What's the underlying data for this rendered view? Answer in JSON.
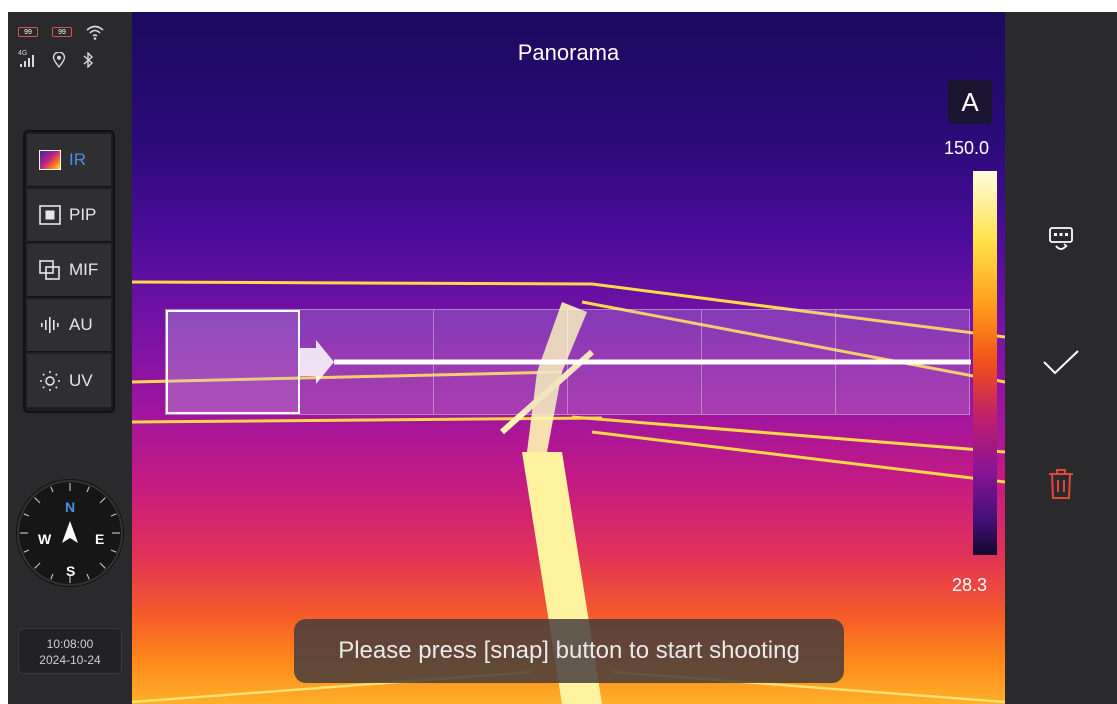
{
  "status_bar": {
    "battery_1": "99",
    "battery_2": "99",
    "signal_label": "4G"
  },
  "modes": [
    {
      "label": "IR",
      "active": true
    },
    {
      "label": "PIP",
      "active": false
    },
    {
      "label": "MIF",
      "active": false
    },
    {
      "label": "AU",
      "active": false
    },
    {
      "label": "UV",
      "active": false
    }
  ],
  "compass": {
    "n": "N",
    "s": "S",
    "e": "E",
    "w": "W"
  },
  "clock": {
    "time": "10:08:00",
    "date": "2024-10-24"
  },
  "title": "Panorama",
  "temperature_scale": {
    "mode_badge": "A",
    "max": "150.0",
    "min": "28.3"
  },
  "panorama": {
    "frames": 6,
    "current_frame": 1
  },
  "toast": "Please press [snap] button to start shooting",
  "colors": {
    "accent": "#4a90e2",
    "delete": "#e0463a",
    "panel": "#2a2a2d"
  },
  "right_actions": [
    {
      "icon": "switch-camera-icon"
    },
    {
      "icon": "check-icon"
    },
    {
      "icon": "trash-icon"
    }
  ]
}
